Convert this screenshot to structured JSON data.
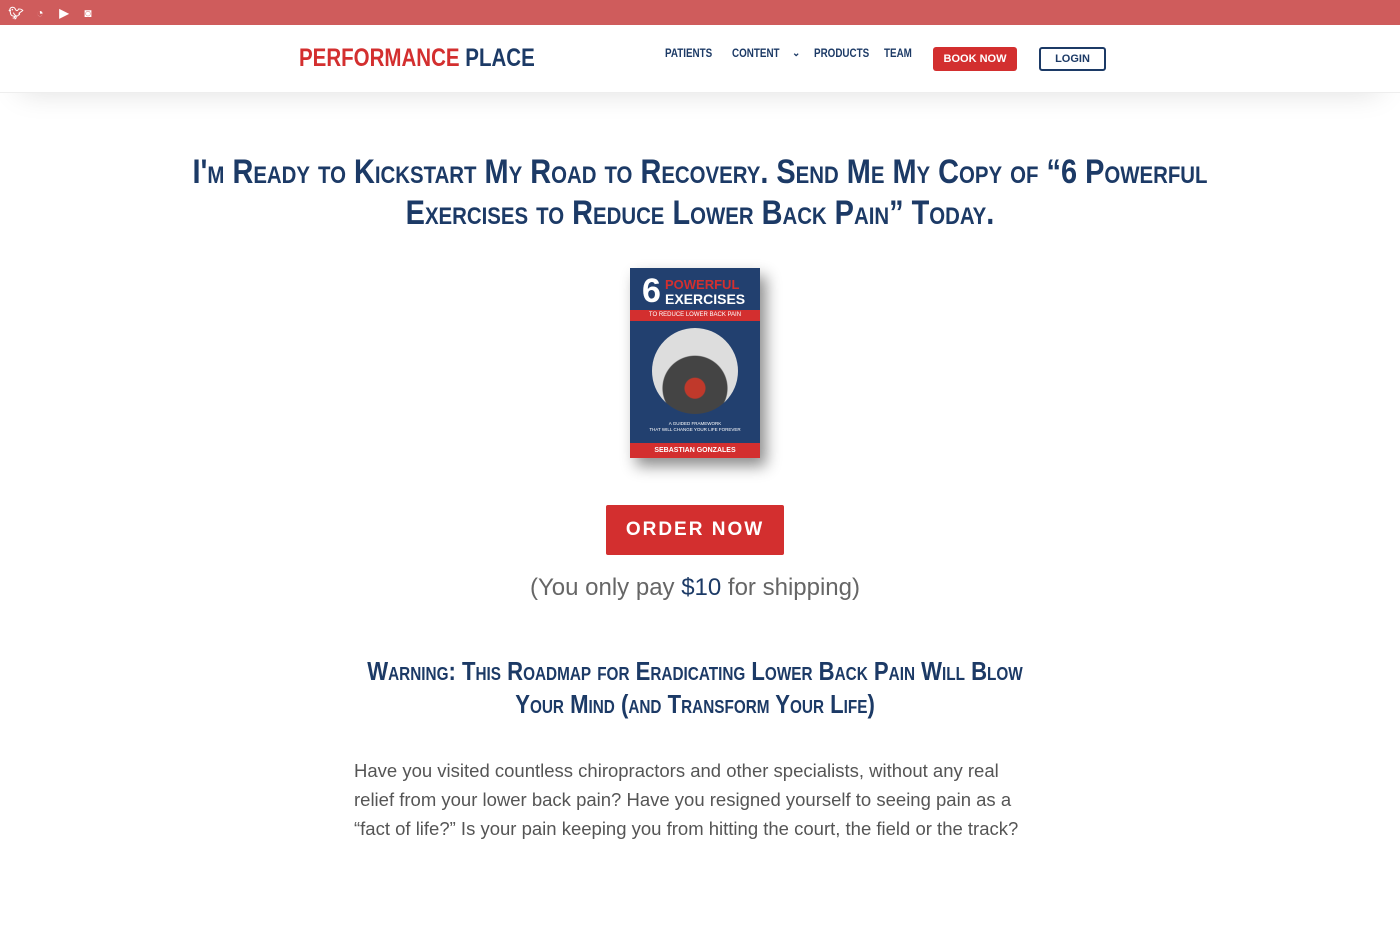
{
  "social": {
    "icons": [
      "twitter-icon",
      "rss-icon",
      "youtube-icon",
      "instagram-icon"
    ]
  },
  "logo": {
    "part1": "PERFORMANCE",
    "part2": "PLACE"
  },
  "nav": {
    "patients": "PATIENTS",
    "content": "CONTENT",
    "products": "PRODUCTS",
    "team": "TEAM",
    "book_now": "BOOK NOW",
    "login": "LOGIN"
  },
  "hero": {
    "title": "I'm Ready to Kickstart My Road to Recovery. Send Me My Copy of “6 Powerful Exercises to Reduce Lower Back Pain” Today."
  },
  "book": {
    "number": "6",
    "line1": "POWERFUL",
    "line2": "EXERCISES",
    "band": "TO REDUCE LOWER BACK PAIN",
    "subtitle1": "A GUIDED FRAMEWORK",
    "subtitle2": "THAT WILL CHANGE YOUR LIFE FOREVER",
    "author": "SEBASTIAN GONZALES"
  },
  "order": {
    "label": "ORDER NOW",
    "ship_pre": "(You only pay ",
    "price": "$10",
    "ship_post": " for shipping)"
  },
  "warning": {
    "title": "Warning: This Roadmap for Eradicating Lower Back Pain Will Blow Your Mind (and Transform Your Life)"
  },
  "body": {
    "paragraph": "Have you visited countless chiropractors and other specialists, without any real relief from your lower back pain? Have you resigned yourself to seeing pain as a “fact of life?” Is your pain keeping you from hitting the court, the field or the track?"
  },
  "colors": {
    "topbar": "#cf5c5c",
    "red": "#d32f2f",
    "navy": "#1c3a66"
  }
}
